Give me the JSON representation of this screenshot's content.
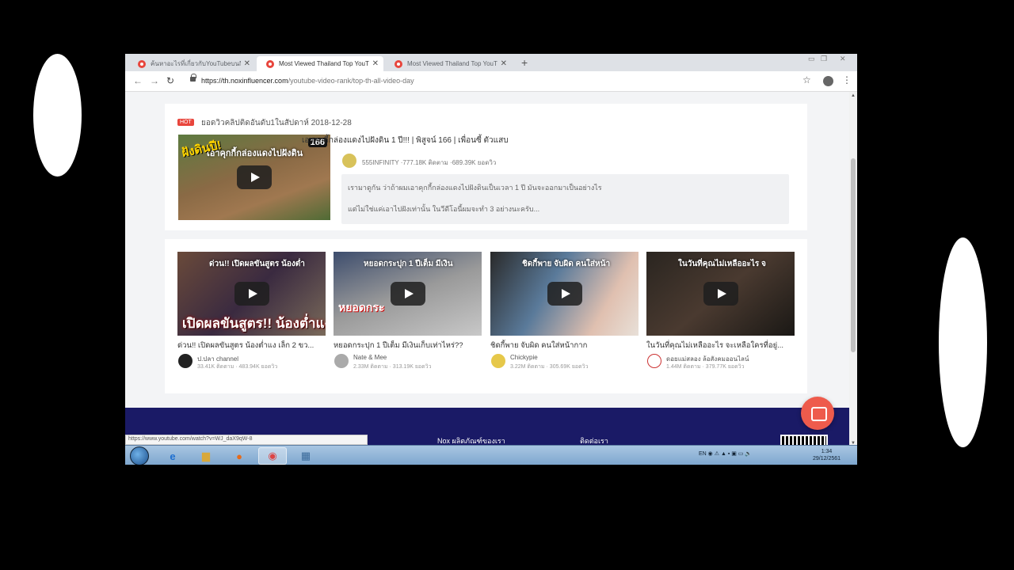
{
  "browser": {
    "tabs": [
      {
        "title": "ค้นหาอะไรที่เกี่ยวกับYouTubeบนNo",
        "active": false
      },
      {
        "title": "Most Viewed Thailand Top YouT",
        "active": true
      },
      {
        "title": "Most Viewed Thailand Top YouT",
        "active": false
      }
    ],
    "new_tab": "+",
    "url_host": "https://th.noxinfluencer.com",
    "url_path": "/youtube-video-rank/top-th-all-video-day",
    "status_url": "https://www.youtube.com/watch?v=WJ_daX9qW-8"
  },
  "hot": {
    "badge": "HOT",
    "title": "ยอดวิวคลิปติดอันดับ1ในสัปดาห์ 2018-12-28",
    "thumb_text": "เอาคุกกี้กล่องแดงไปฝังดิน",
    "thumb_big": "ฝังดินปี!",
    "thumb_num": "166",
    "video_title": "เอาคุกกี้กล่องแดงไปฝังดิน 1 ปี!!! | พิสูจน์ 166 | เพื่อนซี้ ตัวแสบ",
    "channel_info": "555INFINITY ·777.18K ติดตาม ·689.39K ยอดวิว",
    "desc_line1": "เรามาดูกัน ว่าถ้าผมเอาคุกกี้กล่องแดงไปฝังดินเป็นเวลา 1 ปี มันจะออกมาเป็นอย่างไร",
    "desc_line2": "แต่ไม่ใช่แค่เอาไปฝังเท่านั้น ในวีดีโอนี้ผมจะทำ 3 อย่างนะครับ..."
  },
  "videos": [
    {
      "overlay": "ด่วน!! เปิดผลขันสูตร น้องต่ำ",
      "big": "เปิดผลขันสูตร!! น้องต่ำแง",
      "title": "ด่วน!! เปิดผลขันสูตร น้องต่ำแง เล็ก 2 ขว...",
      "channel": "ป.ปลา channel",
      "stats": "33.41K ติดตาม · 483.94K ยอดวิว",
      "bg": "#5a4a3a",
      "avatar": "#222"
    },
    {
      "overlay": "หยอดกระปุก 1 ปีเต็ม มีเงิน",
      "big": "หยอดกระ",
      "title": "หยอดกระปุก 1 ปีเต็ม มีเงินเก็บเท่าไหร่??",
      "channel": "Nate & Mee",
      "stats": "2.33M ติดตาม · 313.19K ยอดวิว",
      "bg": "#8a8a8a",
      "avatar": "#aaa"
    },
    {
      "overlay": "ชิดกี้พาย จับผิด คนใส่หน้า",
      "big": "",
      "title": "ชิดกี้พาย จับผิด คนใส่หน้ากาก",
      "channel": "Chickypie",
      "stats": "3.22M ติดตาม · 305.69K ยอดวิว",
      "bg": "#4a6a8a",
      "avatar": "#e6c84a"
    },
    {
      "overlay": "ในวันที่คุณไม่เหลืออะไร จ",
      "big": "",
      "title": "ในวันที่คุณไม่เหลืออะไร จะเหลือใครที่อยู่...",
      "channel": "ดอยแม่สลอง ล้อสังคมออนไลน์",
      "stats": "1.44M ติดตาม · 379.77K ยอดวิว",
      "bg": "#3a3530",
      "avatar": "#c33"
    }
  ],
  "footer": {
    "products": "Nox ผลิตภัณฑ์ของเรา",
    "contact": "ติดต่อเรา"
  },
  "taskbar": {
    "lang": "EN",
    "time": "1:34",
    "date": "29/12/2561"
  }
}
